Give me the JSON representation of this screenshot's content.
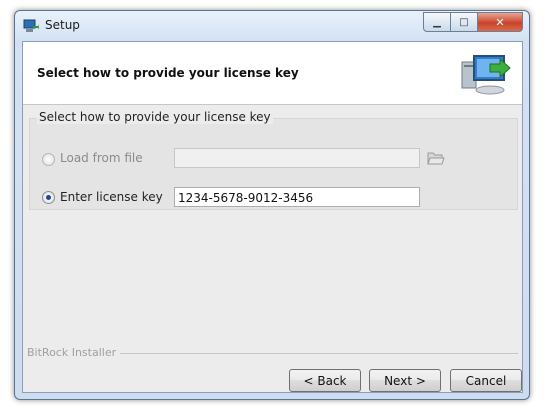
{
  "window": {
    "title": "Setup"
  },
  "header": {
    "title": "Select how to provide your license key"
  },
  "section": {
    "title": "Select how to provide your license key"
  },
  "options": {
    "load_from_file": {
      "label": "Load from file",
      "path_value": "",
      "selected": false,
      "enabled": false
    },
    "enter_license_key": {
      "label": "Enter license key",
      "value": "1234-5678-9012-3456",
      "selected": true
    }
  },
  "footer": {
    "brand": "BitRock Installer"
  },
  "buttons": {
    "back": "< Back",
    "next": "Next >",
    "cancel": "Cancel"
  },
  "colors": {
    "accent": "#1c4b8c",
    "window_frame": "#cddcef",
    "close_button": "#c9442c"
  }
}
